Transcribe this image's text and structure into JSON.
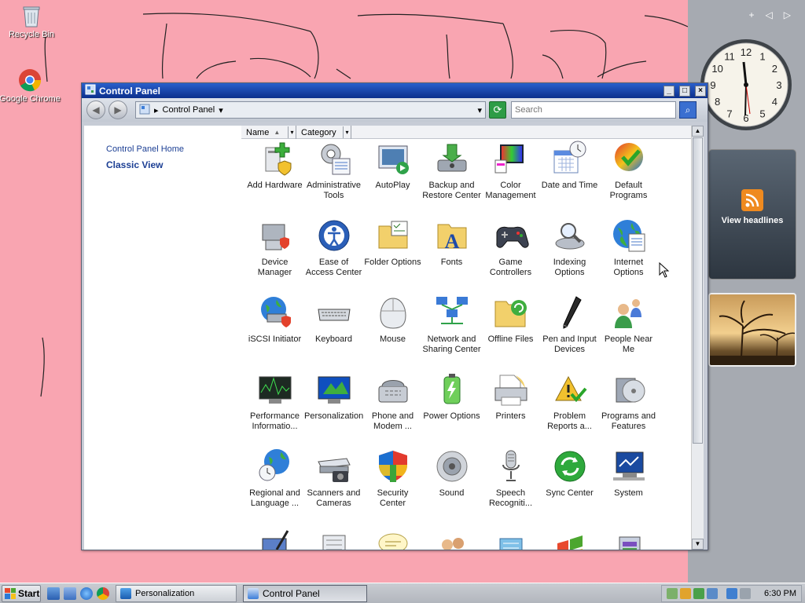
{
  "desktop": {
    "icons": [
      {
        "label": "Recycle Bin",
        "icon": "recycle-bin-icon"
      },
      {
        "label": "Google Chrome",
        "icon": "chrome-icon"
      }
    ],
    "background_color": "#f9a5b1"
  },
  "sidebar": {
    "controls": {
      "add": "+",
      "prev": "◁",
      "next": "▷"
    },
    "clock_numbers": [
      "12",
      "1",
      "2",
      "3",
      "4",
      "5",
      "6",
      "7",
      "8",
      "9",
      "10",
      "11"
    ],
    "feed_label": "View headlines"
  },
  "window": {
    "title": "Control Panel",
    "buttons": {
      "minimize": "_",
      "maximize": "□",
      "close": "×"
    },
    "nav": {
      "back": "◀",
      "forward": "▶"
    },
    "address": {
      "separator": "▸",
      "crumb": "Control Panel",
      "drop": "▾"
    },
    "search_placeholder": "Search",
    "left_links": {
      "home": "Control Panel Home",
      "classic": "Classic View"
    },
    "columns": [
      {
        "label": "Name",
        "sort": "▲"
      },
      {
        "label": "Category",
        "sort": ""
      }
    ],
    "items": [
      {
        "label": "Add Hardware",
        "icon": "add-hardware-icon"
      },
      {
        "label": "Administrative Tools",
        "icon": "administrative-tools-icon"
      },
      {
        "label": "AutoPlay",
        "icon": "autoplay-icon"
      },
      {
        "label": "Backup and Restore Center",
        "icon": "backup-icon"
      },
      {
        "label": "Color Management",
        "icon": "color-management-icon"
      },
      {
        "label": "Date and Time",
        "icon": "date-time-icon"
      },
      {
        "label": "Default Programs",
        "icon": "default-programs-icon"
      },
      {
        "label": "Device Manager",
        "icon": "device-manager-icon"
      },
      {
        "label": "Ease of Access Center",
        "icon": "ease-of-access-icon"
      },
      {
        "label": "Folder Options",
        "icon": "folder-options-icon"
      },
      {
        "label": "Fonts",
        "icon": "fonts-icon"
      },
      {
        "label": "Game Controllers",
        "icon": "game-controllers-icon"
      },
      {
        "label": "Indexing Options",
        "icon": "indexing-options-icon"
      },
      {
        "label": "Internet Options",
        "icon": "internet-options-icon"
      },
      {
        "label": "iSCSI Initiator",
        "icon": "iscsi-icon"
      },
      {
        "label": "Keyboard",
        "icon": "keyboard-icon"
      },
      {
        "label": "Mouse",
        "icon": "mouse-icon"
      },
      {
        "label": "Network and Sharing Center",
        "icon": "network-icon"
      },
      {
        "label": "Offline Files",
        "icon": "offline-files-icon"
      },
      {
        "label": "Pen and Input Devices",
        "icon": "pen-input-icon"
      },
      {
        "label": "People Near Me",
        "icon": "people-near-me-icon"
      },
      {
        "label": "Performance Informatio...",
        "icon": "performance-icon"
      },
      {
        "label": "Personalization",
        "icon": "personalization-icon"
      },
      {
        "label": "Phone and Modem ...",
        "icon": "phone-modem-icon"
      },
      {
        "label": "Power Options",
        "icon": "power-options-icon"
      },
      {
        "label": "Printers",
        "icon": "printers-icon"
      },
      {
        "label": "Problem Reports a...",
        "icon": "problem-reports-icon"
      },
      {
        "label": "Programs and Features",
        "icon": "programs-features-icon"
      },
      {
        "label": "Regional and Language ...",
        "icon": "regional-icon"
      },
      {
        "label": "Scanners and Cameras",
        "icon": "scanners-icon"
      },
      {
        "label": "Security Center",
        "icon": "security-center-icon"
      },
      {
        "label": "Sound",
        "icon": "sound-icon"
      },
      {
        "label": "Speech Recogniti...",
        "icon": "speech-icon"
      },
      {
        "label": "Sync Center",
        "icon": "sync-center-icon"
      },
      {
        "label": "System",
        "icon": "system-icon"
      },
      {
        "label": "",
        "icon": "tablet-pc-icon"
      },
      {
        "label": "",
        "icon": "taskbar-icon"
      },
      {
        "label": "",
        "icon": "text-to-speech-icon"
      },
      {
        "label": "",
        "icon": "user-accounts-icon"
      },
      {
        "label": "",
        "icon": "welcome-center-icon"
      },
      {
        "label": "",
        "icon": "windows-icon"
      },
      {
        "label": "",
        "icon": "windows-cardspace-icon"
      }
    ]
  },
  "taskbar": {
    "start": "Start",
    "tasks": [
      {
        "label": "Personalization",
        "active": false
      },
      {
        "label": "Control Panel",
        "active": true
      }
    ],
    "clock": "6:30 PM"
  }
}
